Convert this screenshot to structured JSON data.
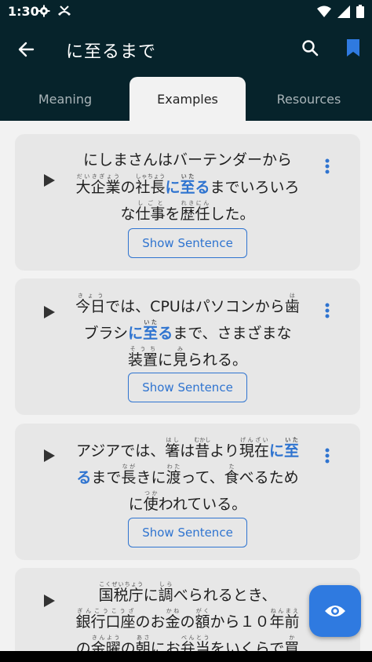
{
  "status": {
    "time": "1:30"
  },
  "app_bar": {
    "title": "に至るまで"
  },
  "tabs": [
    {
      "label": "Meaning"
    },
    {
      "label": "Examples",
      "selected": true
    },
    {
      "label": "Resources"
    }
  ],
  "examples": [
    {
      "lines": [
        "にしまさんはバーテンダーから",
        "大企業の社長に至るまでいろいろ",
        "な仕事を歴任した。"
      ],
      "furigana": {
        "大企業": "だいきぎょう",
        "社長": "しゃちょう",
        "至": "いた",
        "仕事": "しごと",
        "歴任": "れきにん"
      },
      "button": "Show Sentence"
    },
    {
      "lines": [
        "今日では、CPUはパソコンから歯",
        "ブラシに至るまで、さまざまな",
        "装置に見られる。"
      ],
      "furigana": {
        "今日": "きょう",
        "歯": "は",
        "至": "いた",
        "装置": "そうち",
        "見": "み"
      },
      "button": "Show Sentence"
    },
    {
      "lines": [
        "アジアでは、箸は昔より現在に至",
        "るまで長きに渡って、食べるため",
        "に使われている。"
      ],
      "furigana": {
        "箸": "はし",
        "昔": "むかし",
        "現在": "げんざい",
        "至": "いた",
        "長": "なが",
        "渡": "わた",
        "食": "た",
        "使": "つか"
      },
      "button": "Show Sentence"
    },
    {
      "lines": [
        "国税庁に調べられるとき、",
        "銀行口座のお金の額から１０年前",
        "の金曜の朝にお弁当をいくらで買"
      ],
      "furigana": {
        "国税庁": "こくぜいちょう",
        "調": "しら",
        "銀行口座": "ぎんこうこうざ",
        "金": "かね",
        "額": "がく",
        "年前": "ねんまえ",
        "金曜": "きんよう",
        "朝": "あさ",
        "弁当": "べんとう",
        "買": "か"
      }
    }
  ],
  "icons": {
    "back": "arrow-back-icon",
    "search": "search-icon",
    "bookmark": "bookmark-icon",
    "play": "play-icon",
    "more": "more-vert-icon",
    "fab": "eye-icon"
  },
  "colors": {
    "header": "#06232b",
    "accent": "#2f74d0",
    "card": "#e7e7e7",
    "background": "#f2f2f2"
  }
}
